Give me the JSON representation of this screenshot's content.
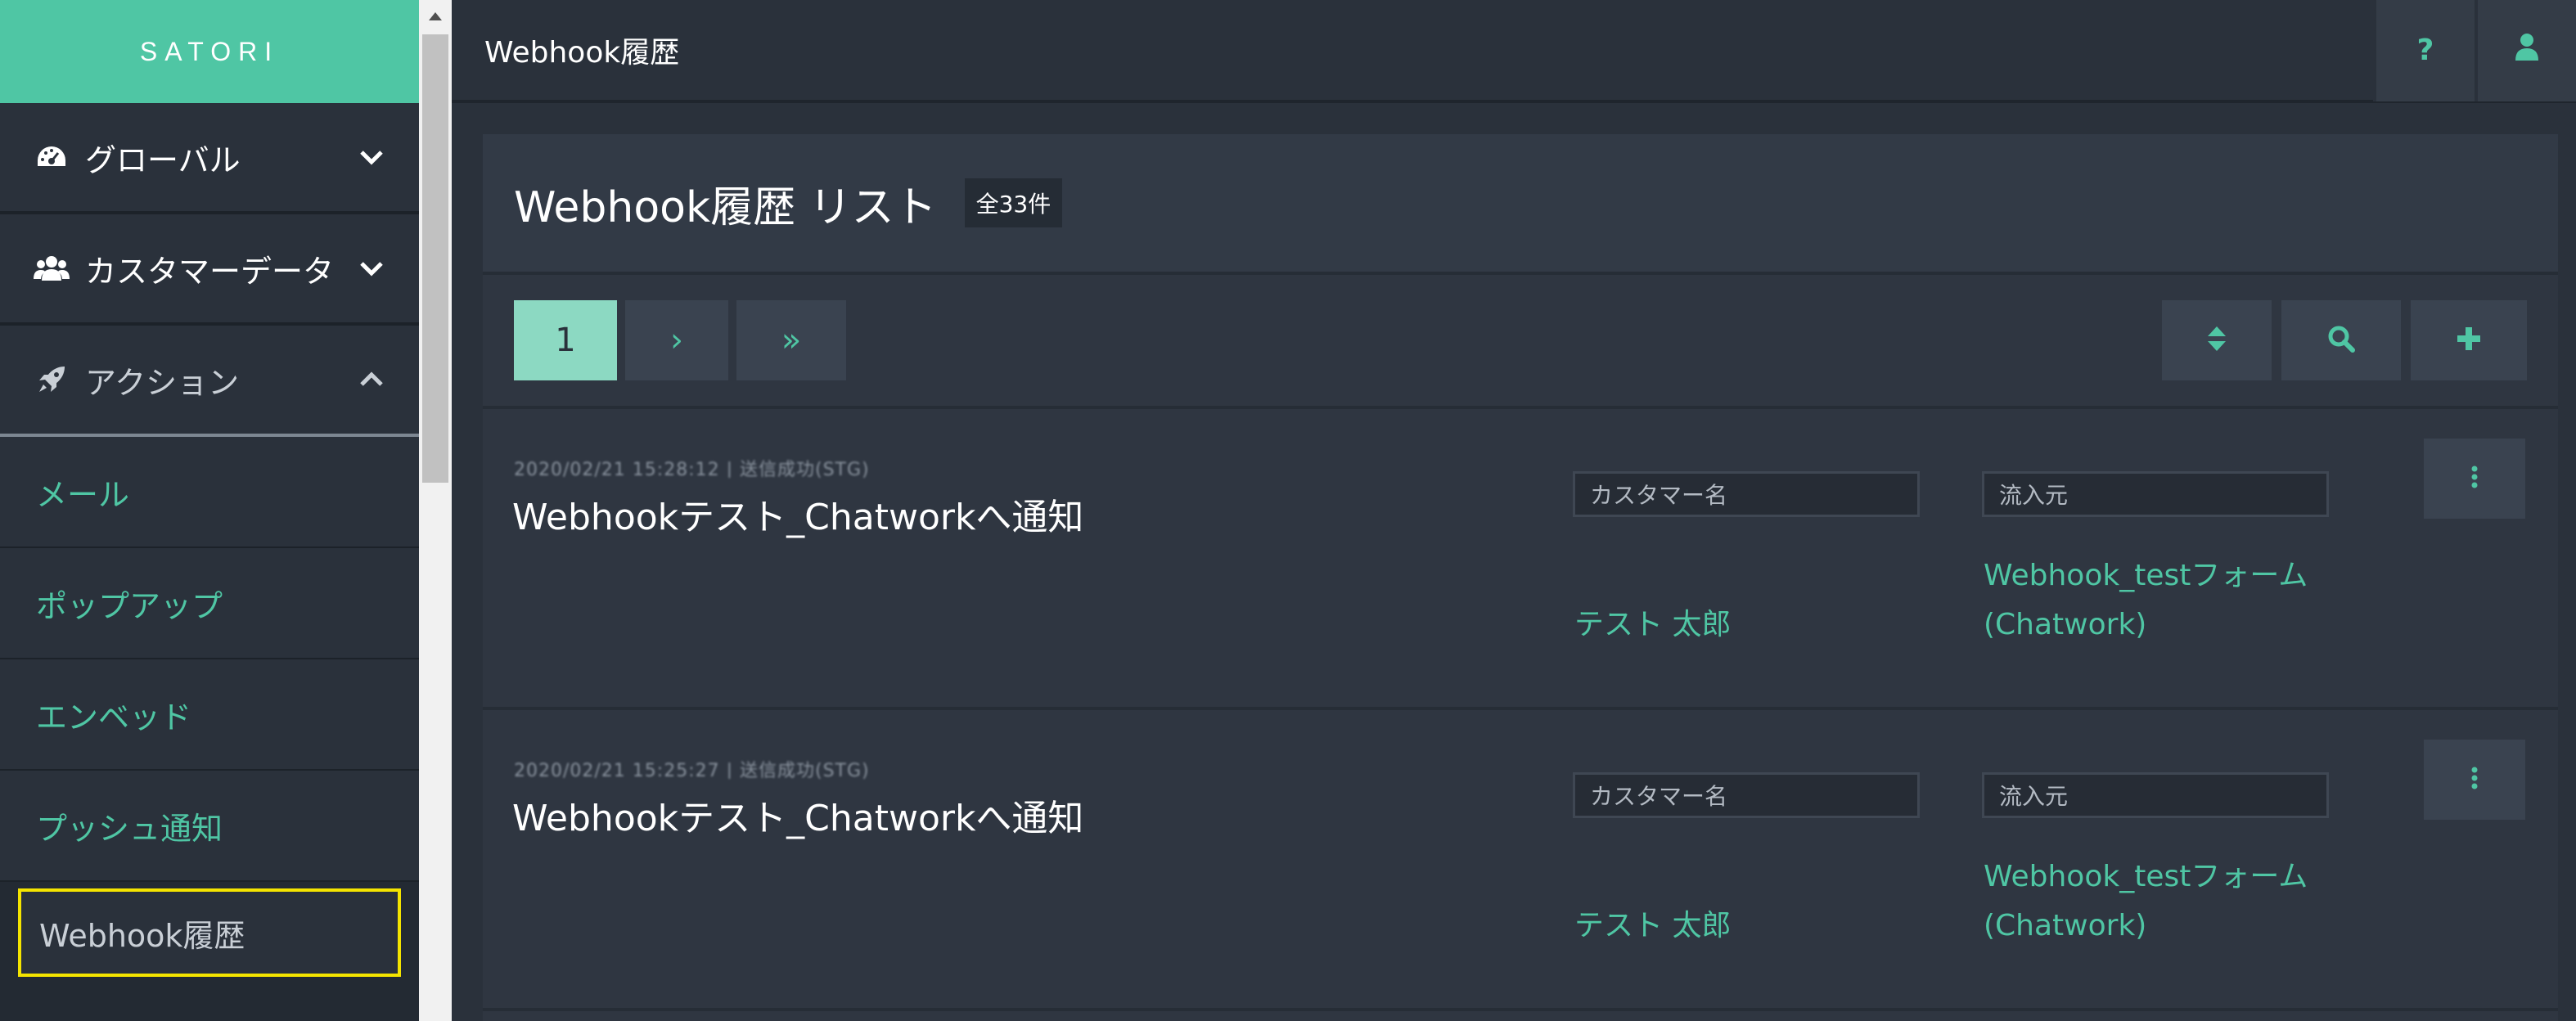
{
  "brand": {
    "logo": "SATORI",
    "accent": "#4fc6a4",
    "highlight": "#f4e400"
  },
  "sidebar": {
    "groups": [
      {
        "label": "グローバル",
        "icon": "dashboard-gauge-icon",
        "expanded": false
      },
      {
        "label": "カスタマーデータ",
        "icon": "users-icon",
        "expanded": false
      },
      {
        "label": "アクション",
        "icon": "rocket-icon",
        "expanded": true
      }
    ],
    "items": [
      {
        "label": "メール"
      },
      {
        "label": "ポップアップ"
      },
      {
        "label": "エンベッド"
      },
      {
        "label": "プッシュ通知"
      },
      {
        "label": "Webhook履歴",
        "active": true
      }
    ]
  },
  "header": {
    "title": "Webhook履歴",
    "help_label": "?",
    "user_icon": "user-icon"
  },
  "panel": {
    "title": "Webhook履歴 リスト",
    "count_badge": "全33件"
  },
  "pagination": {
    "current": "1",
    "next": "›",
    "last": "»"
  },
  "toolbar": {
    "sort_icon": "sort-icon",
    "search_icon": "search-icon",
    "add_icon": "plus-icon"
  },
  "rows": [
    {
      "meta": "2020/02/21 15:28:12 | 送信成功(STG)",
      "title": "Webhookテスト_Chatworkへ通知",
      "customer_label": "カスタマー名",
      "customer_value": "テスト 太郎",
      "source_label": "流入元",
      "source_value_line1": "Webhook_testフォーム",
      "source_value_line2": "(Chatwork)"
    },
    {
      "meta": "2020/02/21 15:25:27 | 送信成功(STG)",
      "title": "Webhookテスト_Chatworkへ通知",
      "customer_label": "カスタマー名",
      "customer_value": "テスト 太郎",
      "source_label": "流入元",
      "source_value_line1": "Webhook_testフォーム",
      "source_value_line2": "(Chatwork)"
    }
  ]
}
